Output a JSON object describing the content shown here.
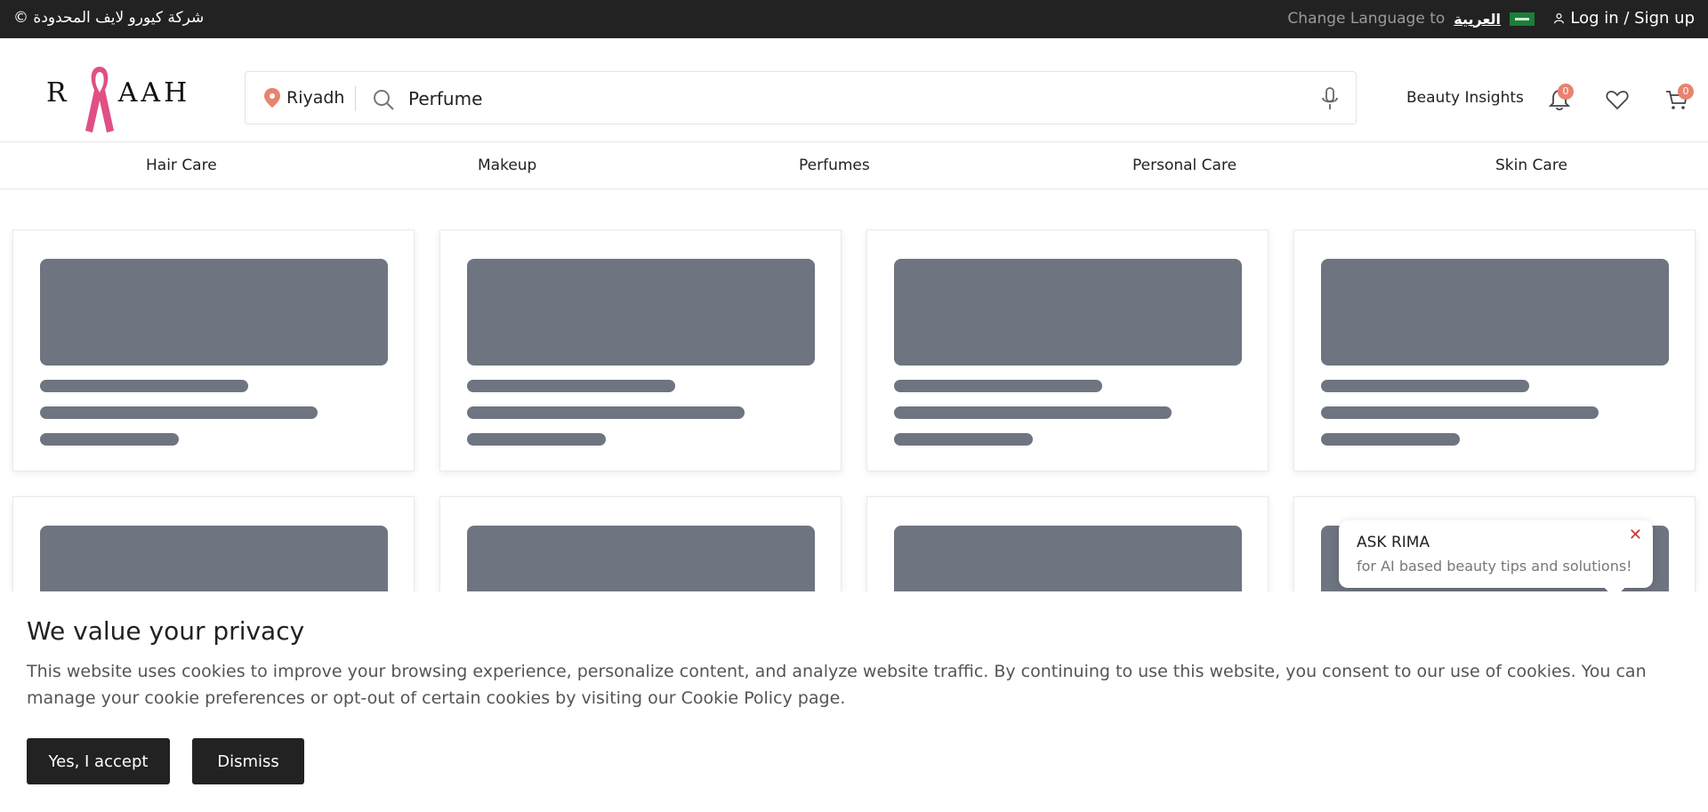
{
  "topbar": {
    "copyright": "© شركة كيورو لايف المحدودة",
    "change_language": "Change Language to",
    "arabic_label": "العربية",
    "login": "Log in / Sign up"
  },
  "header": {
    "location": "Riyadh",
    "search_value": "Perfume",
    "beauty_insights": "Beauty Insights",
    "notification_count": "0",
    "cart_count": "0"
  },
  "categories": [
    "Hair Care",
    "Makeup",
    "Perfumes",
    "Personal Care",
    "Skin Care"
  ],
  "ask_rima": {
    "title": "ASK RIMA",
    "subtitle": "for AI based beauty tips and solutions!",
    "close": "✕"
  },
  "cookie": {
    "title": "We value your privacy",
    "text": "This website uses cookies to improve your browsing experience, personalize content, and analyze website traffic. By continuing to use this website, you consent to our use of cookies. You can manage your cookie preferences or opt-out of certain cookies by visiting our Cookie Policy page.",
    "accept": "Yes, I accept",
    "dismiss": "Dismiss"
  },
  "colors": {
    "topbar_bg": "#222222",
    "accent": "#e8836f",
    "skeleton": "#6e7580",
    "ribbon": "#e04f86"
  }
}
